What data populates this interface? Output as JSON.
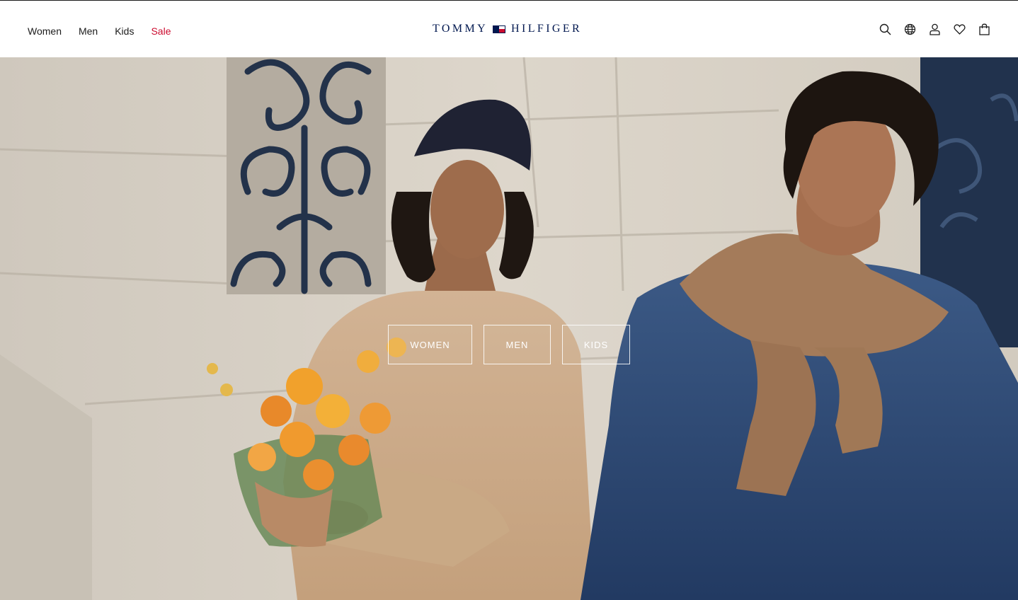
{
  "header": {
    "nav": [
      {
        "label": "Women"
      },
      {
        "label": "Men"
      },
      {
        "label": "Kids"
      },
      {
        "label": "Sale"
      }
    ],
    "logo_left": "TOMMY",
    "logo_right": "HILFIGER",
    "icons": [
      "search-icon",
      "globe-icon",
      "account-icon",
      "wishlist-heart-icon",
      "shopping-bag-icon"
    ]
  },
  "hero": {
    "buttons": [
      {
        "label": "WOMEN"
      },
      {
        "label": "MEN"
      },
      {
        "label": "KIDS"
      }
    ]
  },
  "colors": {
    "brand_navy": "#00174f",
    "sale_red": "#cc0c2f",
    "text": "#1b1b1b"
  }
}
